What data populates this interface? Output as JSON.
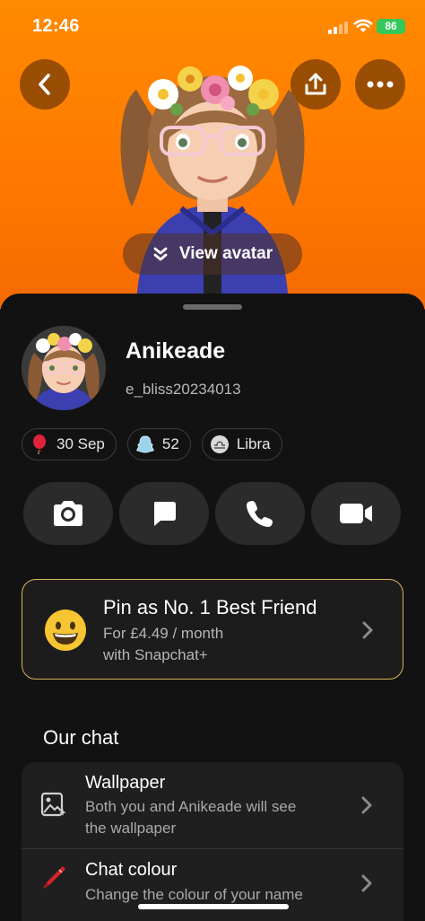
{
  "status_bar": {
    "time": "12:46",
    "battery": "86"
  },
  "hero": {
    "view_avatar_label": "View avatar"
  },
  "profile": {
    "display_name": "Anikeade",
    "username": "e_bliss20234013",
    "chips": [
      {
        "icon": "balloon-icon",
        "label": "30 Sep"
      },
      {
        "icon": "snapscore-icon",
        "label": "52"
      },
      {
        "icon": "libra-icon",
        "label": "Libra"
      }
    ]
  },
  "actions": [
    {
      "icon": "camera-icon"
    },
    {
      "icon": "chat-icon"
    },
    {
      "icon": "phone-icon"
    },
    {
      "icon": "video-icon"
    }
  ],
  "pin_card": {
    "title": "Pin as No. 1 Best Friend",
    "subtitle_line1": "For £4.49 / month",
    "subtitle_line2": "with Snapchat+",
    "accent_color": "#d9b45a"
  },
  "our_chat": {
    "title": "Our chat",
    "items": [
      {
        "title": "Wallpaper",
        "subtitle_line1": "Both you and Anikeade will see",
        "subtitle_line2": "the wallpaper",
        "icon": "wallpaper-icon"
      },
      {
        "title": "Chat colour",
        "subtitle_line1": "Change the colour of your name",
        "icon": "crayon-icon"
      }
    ]
  },
  "colors": {
    "hero_bg": "#ff7a00",
    "sheet_bg": "#121212",
    "card_bg": "#1f1f1f"
  }
}
